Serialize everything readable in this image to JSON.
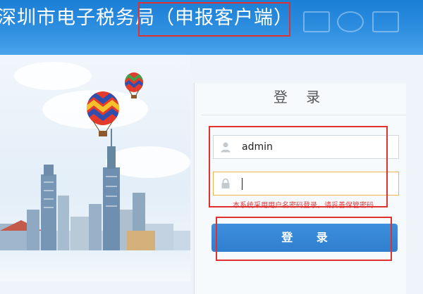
{
  "header": {
    "title": "深圳市电子税务局（申报客户端）"
  },
  "login": {
    "heading": "登 录",
    "username_value": "admin",
    "password_value": "",
    "hint": "本系统采用用户名密码登录，请妥善保管密码",
    "submit_label": "登 录"
  },
  "colors": {
    "banner": "#2f8fe0",
    "button": "#3487d6",
    "highlight": "#e0302f",
    "hint": "#d84040"
  },
  "icons": {
    "user": "user-icon",
    "lock": "lock-icon"
  }
}
